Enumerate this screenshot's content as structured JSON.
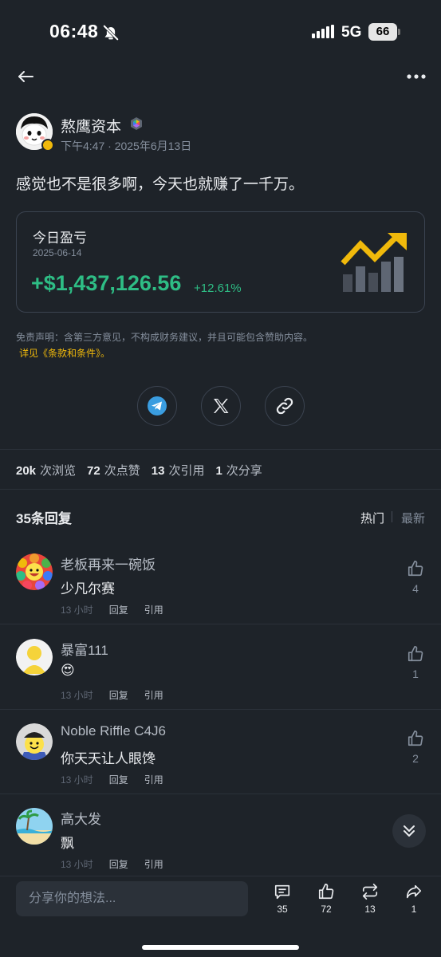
{
  "status_bar": {
    "time": "06:48",
    "network": "5G",
    "battery": "66"
  },
  "post": {
    "author": "熬鹰资本",
    "time": "下午4:47 · 2025年6月13日",
    "text": "感觉也不是很多啊，今天也就赚了一千万。"
  },
  "pnl_card": {
    "title": "今日盈亏",
    "date": "2025-06-14",
    "amount": "+$1,437,126.56",
    "percent": "+12.61%",
    "accent_color": "#2ebd85",
    "chart_color": "#f0b90b"
  },
  "disclaimer": {
    "text": "免责声明：含第三方意见，不构成财务建议，并且可能包含赞助内容。",
    "link": "详见《条款和条件》。"
  },
  "share_buttons": [
    "telegram-icon",
    "x-icon",
    "link-icon"
  ],
  "stats": {
    "views_count": "20k",
    "views_label": "次浏览",
    "likes_count": "72",
    "likes_label": "次点赞",
    "quotes_count": "13",
    "quotes_label": "次引用",
    "shares_count": "1",
    "shares_label": "次分享"
  },
  "replies": {
    "title": "35条回复",
    "sort_hot": "热门",
    "sort_new": "最新",
    "items": [
      {
        "name": "老板再来一碗饭",
        "text": "少凡尔赛",
        "time": "13 小时",
        "reply": "回复",
        "quote": "引用",
        "likes": "4"
      },
      {
        "name": "暴富111",
        "text": "😍",
        "time": "13 小时",
        "reply": "回复",
        "quote": "引用",
        "likes": "1"
      },
      {
        "name": "Noble Riffle C4J6",
        "text": "你天天让人眼馋",
        "time": "13 小时",
        "reply": "回复",
        "quote": "引用",
        "likes": "2"
      },
      {
        "name": "高大发",
        "text": "飘",
        "time": "13 小时",
        "reply": "回复",
        "quote": "引用",
        "likes": ""
      }
    ]
  },
  "bottom_bar": {
    "placeholder": "分享你的想法...",
    "comments": "35",
    "likes": "72",
    "reposts": "13",
    "shares": "1"
  }
}
